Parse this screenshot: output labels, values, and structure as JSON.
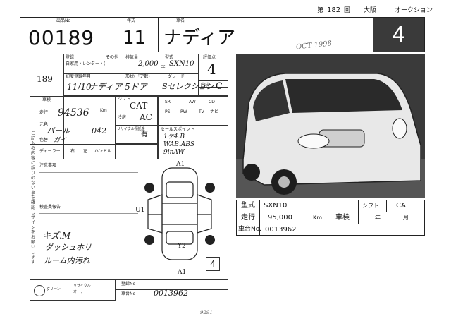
{
  "header": {
    "session_label": "第",
    "session_no": "182",
    "session_suffix": "回",
    "venue": "大阪",
    "title": "オークション"
  },
  "top_labels": {
    "lot_label": "出品No",
    "year_label": "年式",
    "model_label": "車名"
  },
  "lot_number": "00189",
  "year": "11",
  "car_name": "ナディア",
  "grade_score": "4",
  "photo_stamp": "OCT 1998",
  "form": {
    "side_number": "189",
    "registration_label": "登録",
    "usage_label": "自家用・レンター・(",
    "other_label": "その他",
    "displacement_label": "排気量",
    "displacement_value": "2,000",
    "cc": "cc",
    "type_label": "型式",
    "type_value": "SXN10",
    "first_reg_label": "初度登録年月",
    "first_reg_value": "11/10",
    "shape_label": "形状(ドア数)",
    "shape_value": "ナディア 5ドア",
    "grade_label": "グレード",
    "grade_value": "Sセレクション",
    "score_label": "評価点",
    "score_value": "4",
    "interior_label": "内装",
    "interior_value": "C",
    "inspection_label": "車検",
    "mileage_label": "走行",
    "mileage_value": "94536",
    "mileage_unit": "Km",
    "color_label": "元色",
    "color_value": "パール",
    "color_code": "042",
    "color_change_label": "色替",
    "color_change_value": "ガイ",
    "shift_label": "シフト",
    "shift_value": "CAT",
    "aircon_label": "冷房",
    "aircon_value": "AC",
    "equip_labels": [
      "SR",
      "PS",
      "PW",
      "AW",
      "CD",
      "TV",
      "ナビ"
    ],
    "recycle_label": "リサイクル預託金",
    "recycle_value": "有",
    "sales_points_label": "セールスポイント",
    "sales_points": [
      "1ケ4.B",
      "WAB.ABS",
      "9inAW"
    ],
    "dealer_label": "ディーラー",
    "dealer_options": [
      "右",
      "左",
      "ハンドル"
    ],
    "caution_label": "注意事項",
    "inspector_label": "検査員報告",
    "handwritten_notes": [
      "キズ.M",
      "ダッシュホリ",
      "ルーム内汚れ"
    ],
    "diagram_marks": [
      "A1",
      "U1",
      "Y2",
      "A1"
    ],
    "bottom_reg_label": "登録No",
    "chassis_label": "車台No",
    "chassis_value": "0013962",
    "recycle_row": [
      "グリーン",
      "リサイクル",
      "オーナー"
    ],
    "footer_sign": "9291",
    "vertical_note": "ご記入の内容に誤りのない事を確認しサインをお願いします"
  },
  "spec_table": {
    "type_label": "型式",
    "type_value": "SXN10",
    "shift_label": "シフト",
    "shift_value": "CA",
    "mileage_label": "走行",
    "mileage_value": "95,000",
    "mileage_unit": "Km",
    "inspection_label": "車検",
    "year_label": "年",
    "month_label": "月",
    "chassis_label": "車台No.",
    "chassis_value": "0013962"
  }
}
